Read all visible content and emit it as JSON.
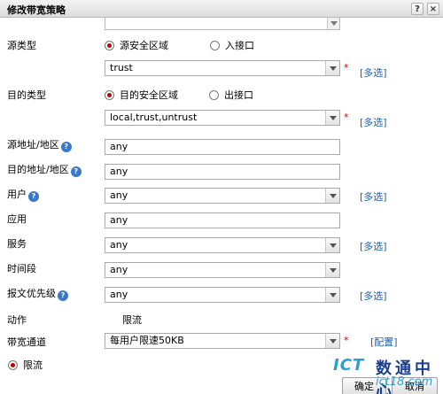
{
  "dialog": {
    "title": "修改带宽策略",
    "help_button": "?",
    "close_button": "×"
  },
  "form": {
    "source_type": {
      "label": "源类型",
      "options": [
        "源安全区域",
        "入接口"
      ],
      "selected": "源安全区域",
      "zone_value": "trust",
      "more_link": "[多选]"
    },
    "dest_type": {
      "label": "目的类型",
      "options": [
        "目的安全区域",
        "出接口"
      ],
      "selected": "目的安全区域",
      "zone_value": "local,trust,untrust",
      "more_link": "[多选]"
    },
    "source_address": {
      "label": "源地址/地区",
      "value": "any"
    },
    "dest_address": {
      "label": "目的地址/地区",
      "value": "any"
    },
    "user": {
      "label": "用户",
      "value": "any",
      "more_link": "[多选]"
    },
    "application": {
      "label": "应用",
      "value": "any"
    },
    "service": {
      "label": "服务",
      "value": "any",
      "more_link": "[多选]"
    },
    "time_range": {
      "label": "时间段",
      "value": "any"
    },
    "packet_priority": {
      "label": "报文优先级",
      "value": "any",
      "more_link": "[多选]"
    },
    "action": {
      "label": "动作",
      "value": "限流"
    },
    "bandwidth_channel": {
      "label": "带宽通道",
      "value": "每用户限速50KB",
      "config_link": "[配置]"
    },
    "limit_radio": {
      "label": "限流",
      "checked": true
    },
    "required_mark": "*",
    "help_glyph": "?"
  },
  "footer": {
    "ok": "确定",
    "cancel": "取消"
  },
  "watermark": {
    "brand": "ICT",
    "cn": "数通中心",
    "url": "ict18.com"
  },
  "colors": {
    "link": "#1a5fb4",
    "required": "#d00000",
    "radio_checked": "#c00000",
    "help_icon": "#3a78c9"
  }
}
